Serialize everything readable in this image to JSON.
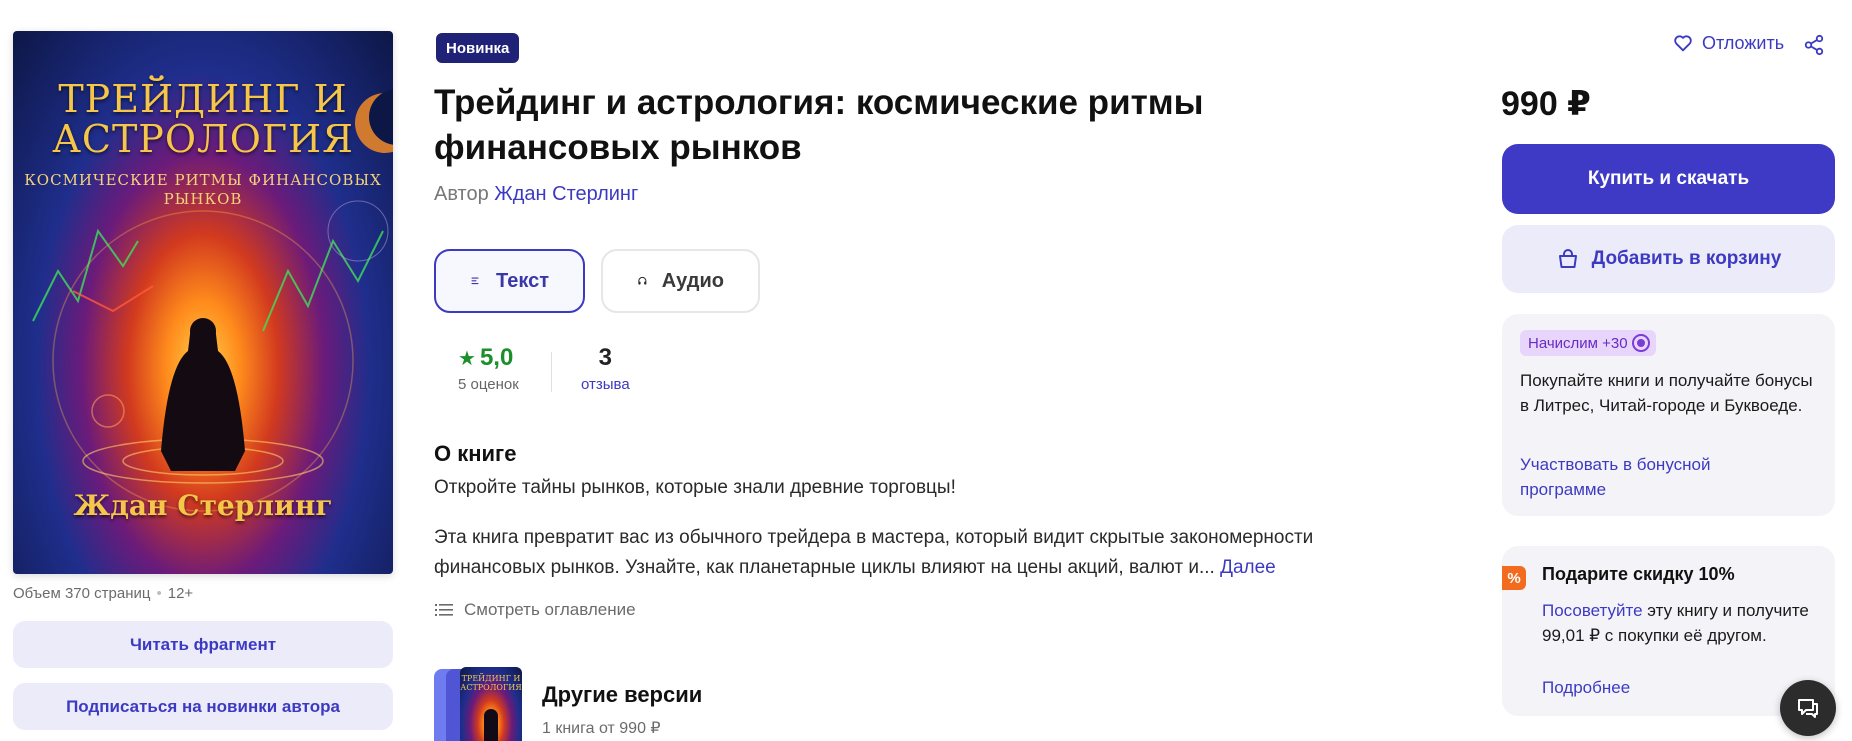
{
  "cover": {
    "title": "ТРЕЙДИНГ И АСТРОЛОГИЯ",
    "subtitle": "КОСМИЧЕСКИЕ РИТМЫ ФИНАНСОВЫХ РЫНКОВ",
    "author": "Ждан Стерлинг"
  },
  "meta": {
    "volume": "Объем 370 страниц",
    "age": "12+"
  },
  "left_actions": {
    "read_fragment": "Читать фрагмент",
    "subscribe": "Подписаться на новинки автора"
  },
  "badge": "Новинка",
  "book": {
    "title": "Трейдинг и астрология: космические ритмы финансовых рынков",
    "author_prefix": "Автор",
    "author_name": "Ждан Стерлинг"
  },
  "formats": {
    "text": "Текст",
    "audio": "Аудио"
  },
  "rating": {
    "value": "5,0",
    "count_label": "5 оценок",
    "reviews_value": "3",
    "reviews_label": "отзыва"
  },
  "about": {
    "heading": "О книге",
    "lead": "Откройте тайны рынков, которые знали древние торговцы!",
    "body": "Эта книга превратит вас из обычного трейдера в мастера, который видит скрытые закономерности финансовых рынков. Узнайте, как планетарные циклы влияют на цены акций, валют и...",
    "more": "Далее",
    "toc": "Смотреть оглавление"
  },
  "versions": {
    "title": "Другие версии",
    "subtitle": "1 книга от 990 ₽",
    "thumb_title": "ТРЕЙДИНГ И АСТРОЛОГИЯ"
  },
  "purchase": {
    "postpone": "Отложить",
    "price": "990 ₽",
    "buy": "Купить и скачать",
    "add_to_cart": "Добавить в корзину"
  },
  "bonus": {
    "badge": "Начислим +30",
    "text": "Покупайте книги и получайте бонусы в Литрес, Читай-городе и Буквоеде.",
    "link": "Участвовать в бонусной программе"
  },
  "gift": {
    "icon": "%",
    "title": "Подарите скидку 10%",
    "link": "Посоветуйте",
    "text": " эту книгу и получите 99,01 ₽ с покупки её другом.",
    "more": "Подробнее"
  },
  "colors": {
    "accent": "#3e3ac6",
    "badge_bg": "#1f2277",
    "rating_green": "#1a8f2a",
    "soft_bg": "#ecebfa"
  }
}
